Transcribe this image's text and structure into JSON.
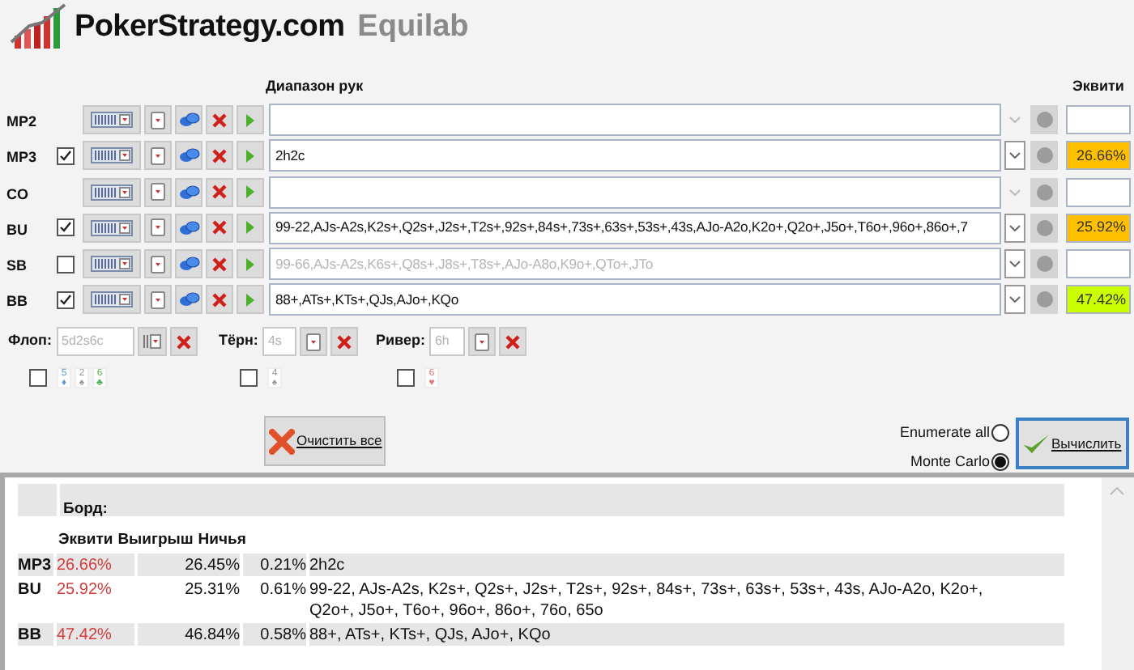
{
  "logo": {
    "brand": "PokerStrategy.com",
    "product": "Equilab"
  },
  "players": {
    "range_header": "Диапазон рук",
    "equity_header": "Эквити",
    "rows": [
      {
        "position": "MP2",
        "checked": null
      },
      {
        "position": "MP3",
        "checked": true,
        "range": "2h2c",
        "equity": "26.66%",
        "color": "#ffc000"
      },
      {
        "position": "CO",
        "checked": null
      },
      {
        "position": "BU",
        "checked": true,
        "range": "99-22,AJs-A2s,K2s+,Q2s+,J2s+,T2s+,92s+,84s+,73s+,63s+,53s+,43s,AJo-A2o,K2o+,Q2o+,J5o+,T6o+,96o+,86o+,7",
        "equity": "25.92%",
        "color": "#ffc000"
      },
      {
        "position": "SB",
        "checked": false,
        "range": "99-66,AJs-A2s,K6s+,Q8s+,J8s+,T8s+,AJo-A8o,K9o+,QTo+,JTo"
      },
      {
        "position": "BB",
        "checked": true,
        "range": "88+,ATs+,KTs+,QJs,AJo+,KQo",
        "equity": "47.42%",
        "color": "#ccff00"
      }
    ]
  },
  "board": [
    {
      "label": "Флоп:",
      "cards": "5d2s6c",
      "checked": false,
      "minis": [
        {
          "rank": "5",
          "suit": "♦",
          "color": "#5b9bd5"
        },
        {
          "rank": "2",
          "suit": "♠",
          "color": "#9a9a9a"
        },
        {
          "rank": "6",
          "suit": "♣",
          "color": "#4caf50"
        }
      ]
    },
    {
      "label": "Тёрн:",
      "cards": "4s",
      "checked": false,
      "minis": [
        {
          "rank": "4",
          "suit": "♠",
          "color": "#9a9a9a"
        }
      ]
    },
    {
      "label": "Ривер:",
      "cards": "6h",
      "checked": false,
      "minis": [
        {
          "rank": "6",
          "suit": "♥",
          "color": "#e57373"
        }
      ]
    }
  ],
  "clear_button": "Очистить все",
  "modes": [
    {
      "label": "Enumerate all",
      "selected": false
    },
    {
      "label": "Monte Carlo",
      "selected": true
    }
  ],
  "calculate_button": "Вычислить",
  "results": {
    "board_label": "Борд:",
    "columns": [
      "Эквити",
      "Выигрыш",
      "Ничья"
    ],
    "rows": [
      {
        "position": "MP3",
        "equity": "26.66%",
        "win": "26.45%",
        "tie": "0.21%",
        "hands": "2h2c"
      },
      {
        "position": "BU",
        "equity": "25.92%",
        "win": "25.31%",
        "tie": "0.61%",
        "hands": "99-22, AJs-A2s, K2s+, Q2s+, J2s+, T2s+, 92s+, 84s+, 73s+, 63s+, 53s+, 43s, AJo-A2o, K2o+, Q2o+, J5o+, T6o+, 96o+, 86o+, 76o, 65o"
      },
      {
        "position": "BB",
        "equity": "47.42%",
        "win": "46.84%",
        "tie": "0.58%",
        "hands": "88+, ATs+, KTs+, QJs, AJo+, KQo"
      }
    ]
  }
}
